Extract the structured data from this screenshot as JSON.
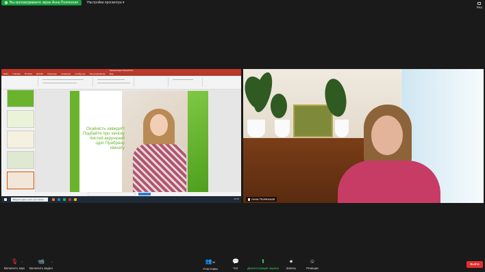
{
  "top": {
    "share_banner": "Вы просматриваете экран Анна Полянская",
    "view_options": "Настройки просмотра",
    "view_button": "Вид"
  },
  "shared_screen": {
    "ppt_title": "Презентация PowerPoint",
    "ppt_tabs": [
      "Файл",
      "Главная",
      "Вставка",
      "Дизайн",
      "Переходы",
      "Анимация",
      "Слайд-шоу",
      "Рецензирование",
      "Вид"
    ],
    "slide_text": "Охайність завжди!!! Подбайте про зачіску Чистий вкручений одяг Прибрану кімнату",
    "taskbar_search": "Введите здесь текст для поиска",
    "taskbar_time": "10:15"
  },
  "camera": {
    "participant_name": "Анна Полянская"
  },
  "toolbar": {
    "mute": "Включить звук",
    "video": "Включить видео",
    "participants": "Участники",
    "participants_count": "46",
    "chat": "Чат",
    "share_screen": "Демонстрация экрана",
    "record": "Запись",
    "reactions": "Реакции",
    "end": "Выйти"
  },
  "colors": {
    "share_green": "#1b9c3c",
    "slide_green": "#6ab42d",
    "end_red": "#e02f2f"
  },
  "icons": {
    "mute": "mic-off-icon",
    "video": "video-off-icon",
    "participants": "participants-icon",
    "chat": "chat-icon",
    "share_screen": "share-screen-icon",
    "record": "record-icon",
    "reactions": "reactions-icon"
  }
}
